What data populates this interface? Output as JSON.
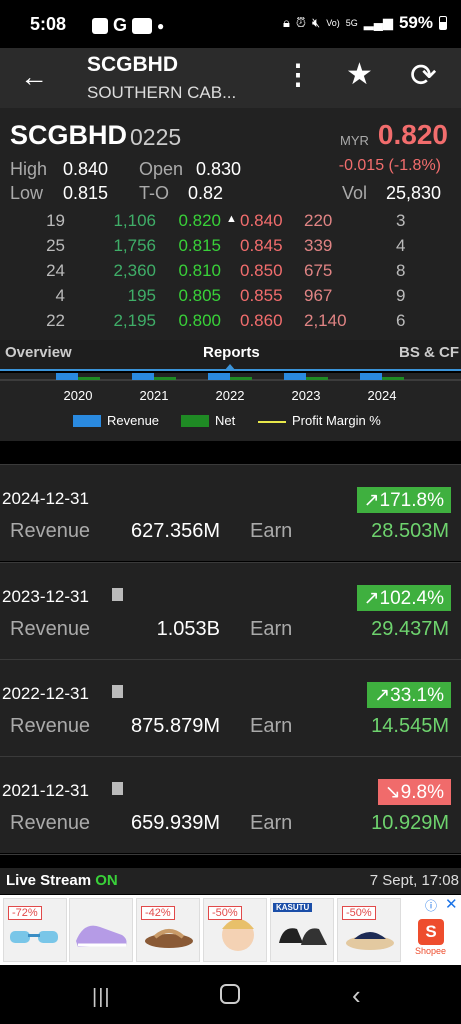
{
  "status_bar": {
    "time": "5:08",
    "battery": "59%",
    "network": "LTE",
    "network_gen": "5G",
    "volte": "Vo)",
    "icons": [
      "image-icon",
      "google-icon",
      "youtube-icon",
      "dot-icon",
      "lock-icon",
      "alarm-icon",
      "mute-icon",
      "signal-icon",
      "battery-icon"
    ]
  },
  "header": {
    "title": "SCGBHD",
    "subtitle": "SOUTHERN CAB...",
    "icons": [
      "back-arrow-icon",
      "more-vert-icon",
      "star-icon",
      "refresh-icon"
    ]
  },
  "quote": {
    "code": "SCGBHD",
    "number": "0225",
    "currency": "MYR",
    "price": "0.820",
    "high_label": "High",
    "high": "0.840",
    "open_label": "Open",
    "open": "0.830",
    "low_label": "Low",
    "low": "0.815",
    "to_label": "T-O",
    "to": "0.82",
    "change": "-0.015 (-1.8%)",
    "vol_label": "Vol",
    "vol": "25,830"
  },
  "market_depth": [
    {
      "bid_q": "19",
      "bid_v": "1,106",
      "bid": "0.820",
      "ask": "0.840",
      "ask_v": "220",
      "ask_q": "3"
    },
    {
      "bid_q": "25",
      "bid_v": "1,756",
      "bid": "0.815",
      "ask": "0.845",
      "ask_v": "339",
      "ask_q": "4"
    },
    {
      "bid_q": "24",
      "bid_v": "2,360",
      "bid": "0.810",
      "ask": "0.850",
      "ask_v": "675",
      "ask_q": "8"
    },
    {
      "bid_q": "4",
      "bid_v": "195",
      "bid": "0.805",
      "ask": "0.855",
      "ask_v": "967",
      "ask_q": "9"
    },
    {
      "bid_q": "22",
      "bid_v": "2,195",
      "bid": "0.800",
      "ask": "0.860",
      "ask_v": "2,140",
      "ask_q": "6"
    }
  ],
  "tabs": [
    {
      "label": "Overview",
      "active": false
    },
    {
      "label": "Reports",
      "active": true
    },
    {
      "label": "BS & CF",
      "active": false
    }
  ],
  "chart_data": {
    "type": "bar",
    "categories": [
      "2020",
      "2021",
      "2022",
      "2023",
      "2024"
    ],
    "series": [
      {
        "name": "Revenue",
        "color": "#2a8ae0"
      },
      {
        "name": "Net",
        "color": "#1f8a24"
      },
      {
        "name": "Profit Margin %",
        "color": "#e8e84a"
      }
    ],
    "legend": "bottom"
  },
  "reports": [
    {
      "date": "2024-12-31",
      "has_doc": false,
      "change": "↗171.8%",
      "direction": "up",
      "revenue_label": "Revenue",
      "revenue": "627.356M",
      "earn_label": "Earn",
      "earn": "28.503M"
    },
    {
      "date": "2023-12-31",
      "has_doc": true,
      "change": "↗102.4%",
      "direction": "up",
      "revenue_label": "Revenue",
      "revenue": "1.053B",
      "earn_label": "Earn",
      "earn": "29.437M"
    },
    {
      "date": "2022-12-31",
      "has_doc": true,
      "change": "↗33.1%",
      "direction": "up",
      "revenue_label": "Revenue",
      "revenue": "875.879M",
      "earn_label": "Earn",
      "earn": "14.545M"
    },
    {
      "date": "2021-12-31",
      "has_doc": true,
      "change": "↘9.8%",
      "direction": "down",
      "revenue_label": "Revenue",
      "revenue": "659.939M",
      "earn_label": "Earn",
      "earn": "10.929M"
    }
  ],
  "live": {
    "label": "Live Stream",
    "status": "ON",
    "timestamp": "7 Sept, 17:08"
  },
  "ad": {
    "tags": [
      "-72%",
      "",
      "-42%",
      "-50%",
      "KASUTU",
      "-50%"
    ],
    "brand": "Shopee",
    "logo_letter": "S"
  },
  "colors": {
    "up": "#3fb03f",
    "down": "#f06b6b",
    "accent": "#3b94d9"
  }
}
